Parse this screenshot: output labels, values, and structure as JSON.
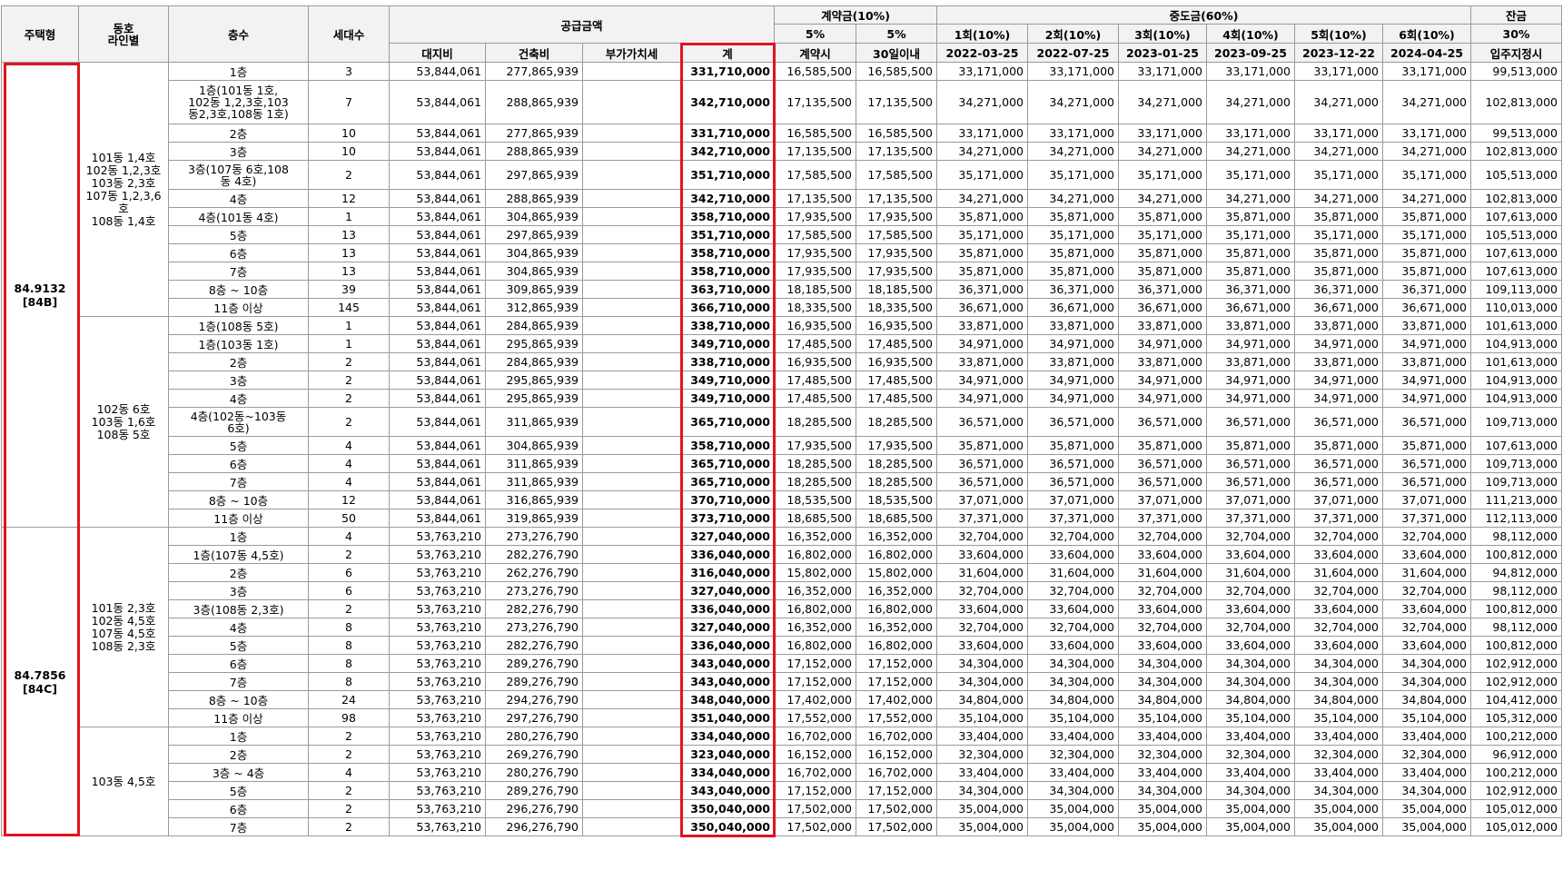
{
  "headers": {
    "type": "주택형",
    "line": "동호\n라인별",
    "floor": "층수",
    "units": "세대수",
    "supply": "공급금액",
    "land": "대지비",
    "building": "건축비",
    "vat": "부가가치세",
    "total": "계",
    "deposit": "계약금(10%)",
    "deposit_pct1": "5%",
    "deposit_pct2": "5%",
    "deposit_sub1": "계약시",
    "deposit_sub2": "30일이내",
    "middle": "중도금(60%)",
    "installments": [
      {
        "label": "1회(10%)",
        "date": "2022-03-25"
      },
      {
        "label": "2회(10%)",
        "date": "2022-07-25"
      },
      {
        "label": "3회(10%)",
        "date": "2023-01-25"
      },
      {
        "label": "4회(10%)",
        "date": "2023-09-25"
      },
      {
        "label": "5회(10%)",
        "date": "2023-12-22"
      },
      {
        "label": "6회(10%)",
        "date": "2024-04-25"
      }
    ],
    "balance": "잔금",
    "balance_pct": "30%",
    "balance_sub": "입주지정시"
  },
  "groups": [
    {
      "type": "84.9132\n[84B]",
      "lines": [
        {
          "label": "101동 1,4호\n102동 1,2,3호\n103동 2,3호\n107동 1,2,3,6호\n108동 1,4호",
          "rows": [
            {
              "floor": "1층",
              "units": "3",
              "land": "53,844,061",
              "building": "277,865,939",
              "total": "331,710,000",
              "d1": "16,585,500",
              "d2": "16,585,500",
              "mid": "33,171,000",
              "bal": "99,513,000"
            },
            {
              "floor": "1층(101동 1호,\n102동 1,2,3호,103\n동2,3호,108동 1호)",
              "units": "7",
              "land": "53,844,061",
              "building": "288,865,939",
              "total": "342,710,000",
              "d1": "17,135,500",
              "d2": "17,135,500",
              "mid": "34,271,000",
              "bal": "102,813,000"
            },
            {
              "floor": "2층",
              "units": "10",
              "land": "53,844,061",
              "building": "277,865,939",
              "total": "331,710,000",
              "d1": "16,585,500",
              "d2": "16,585,500",
              "mid": "33,171,000",
              "bal": "99,513,000"
            },
            {
              "floor": "3층",
              "units": "10",
              "land": "53,844,061",
              "building": "288,865,939",
              "total": "342,710,000",
              "d1": "17,135,500",
              "d2": "17,135,500",
              "mid": "34,271,000",
              "bal": "102,813,000"
            },
            {
              "floor": "3층(107동 6호,108\n동 4호)",
              "units": "2",
              "land": "53,844,061",
              "building": "297,865,939",
              "total": "351,710,000",
              "d1": "17,585,500",
              "d2": "17,585,500",
              "mid": "35,171,000",
              "bal": "105,513,000"
            },
            {
              "floor": "4층",
              "units": "12",
              "land": "53,844,061",
              "building": "288,865,939",
              "total": "342,710,000",
              "d1": "17,135,500",
              "d2": "17,135,500",
              "mid": "34,271,000",
              "bal": "102,813,000"
            },
            {
              "floor": "4층(101동 4호)",
              "units": "1",
              "land": "53,844,061",
              "building": "304,865,939",
              "total": "358,710,000",
              "d1": "17,935,500",
              "d2": "17,935,500",
              "mid": "35,871,000",
              "bal": "107,613,000"
            },
            {
              "floor": "5층",
              "units": "13",
              "land": "53,844,061",
              "building": "297,865,939",
              "total": "351,710,000",
              "d1": "17,585,500",
              "d2": "17,585,500",
              "mid": "35,171,000",
              "bal": "105,513,000"
            },
            {
              "floor": "6층",
              "units": "13",
              "land": "53,844,061",
              "building": "304,865,939",
              "total": "358,710,000",
              "d1": "17,935,500",
              "d2": "17,935,500",
              "mid": "35,871,000",
              "bal": "107,613,000"
            },
            {
              "floor": "7층",
              "units": "13",
              "land": "53,844,061",
              "building": "304,865,939",
              "total": "358,710,000",
              "d1": "17,935,500",
              "d2": "17,935,500",
              "mid": "35,871,000",
              "bal": "107,613,000"
            },
            {
              "floor": "8층 ~ 10층",
              "units": "39",
              "land": "53,844,061",
              "building": "309,865,939",
              "total": "363,710,000",
              "d1": "18,185,500",
              "d2": "18,185,500",
              "mid": "36,371,000",
              "bal": "109,113,000"
            },
            {
              "floor": "11층 이상",
              "units": "145",
              "land": "53,844,061",
              "building": "312,865,939",
              "total": "366,710,000",
              "d1": "18,335,500",
              "d2": "18,335,500",
              "mid": "36,671,000",
              "bal": "110,013,000"
            }
          ]
        },
        {
          "label": "102동 6호\n103동 1,6호\n108동 5호",
          "rows": [
            {
              "floor": "1층(108동 5호)",
              "units": "1",
              "land": "53,844,061",
              "building": "284,865,939",
              "total": "338,710,000",
              "d1": "16,935,500",
              "d2": "16,935,500",
              "mid": "33,871,000",
              "bal": "101,613,000"
            },
            {
              "floor": "1층(103동 1호)",
              "units": "1",
              "land": "53,844,061",
              "building": "295,865,939",
              "total": "349,710,000",
              "d1": "17,485,500",
              "d2": "17,485,500",
              "mid": "34,971,000",
              "bal": "104,913,000"
            },
            {
              "floor": "2층",
              "units": "2",
              "land": "53,844,061",
              "building": "284,865,939",
              "total": "338,710,000",
              "d1": "16,935,500",
              "d2": "16,935,500",
              "mid": "33,871,000",
              "bal": "101,613,000"
            },
            {
              "floor": "3층",
              "units": "2",
              "land": "53,844,061",
              "building": "295,865,939",
              "total": "349,710,000",
              "d1": "17,485,500",
              "d2": "17,485,500",
              "mid": "34,971,000",
              "bal": "104,913,000"
            },
            {
              "floor": "4층",
              "units": "2",
              "land": "53,844,061",
              "building": "295,865,939",
              "total": "349,710,000",
              "d1": "17,485,500",
              "d2": "17,485,500",
              "mid": "34,971,000",
              "bal": "104,913,000"
            },
            {
              "floor": "4층(102동~103동\n6호)",
              "units": "2",
              "land": "53,844,061",
              "building": "311,865,939",
              "total": "365,710,000",
              "d1": "18,285,500",
              "d2": "18,285,500",
              "mid": "36,571,000",
              "bal": "109,713,000"
            },
            {
              "floor": "5층",
              "units": "4",
              "land": "53,844,061",
              "building": "304,865,939",
              "total": "358,710,000",
              "d1": "17,935,500",
              "d2": "17,935,500",
              "mid": "35,871,000",
              "bal": "107,613,000"
            },
            {
              "floor": "6층",
              "units": "4",
              "land": "53,844,061",
              "building": "311,865,939",
              "total": "365,710,000",
              "d1": "18,285,500",
              "d2": "18,285,500",
              "mid": "36,571,000",
              "bal": "109,713,000"
            },
            {
              "floor": "7층",
              "units": "4",
              "land": "53,844,061",
              "building": "311,865,939",
              "total": "365,710,000",
              "d1": "18,285,500",
              "d2": "18,285,500",
              "mid": "36,571,000",
              "bal": "109,713,000"
            },
            {
              "floor": "8층 ~ 10층",
              "units": "12",
              "land": "53,844,061",
              "building": "316,865,939",
              "total": "370,710,000",
              "d1": "18,535,500",
              "d2": "18,535,500",
              "mid": "37,071,000",
              "bal": "111,213,000"
            },
            {
              "floor": "11층 이상",
              "units": "50",
              "land": "53,844,061",
              "building": "319,865,939",
              "total": "373,710,000",
              "d1": "18,685,500",
              "d2": "18,685,500",
              "mid": "37,371,000",
              "bal": "112,113,000"
            }
          ]
        }
      ]
    },
    {
      "type": "84.7856\n[84C]",
      "lines": [
        {
          "label": "101동 2,3호\n102동 4,5호\n107동 4,5호\n108동 2,3호",
          "rows": [
            {
              "floor": "1층",
              "units": "4",
              "land": "53,763,210",
              "building": "273,276,790",
              "total": "327,040,000",
              "d1": "16,352,000",
              "d2": "16,352,000",
              "mid": "32,704,000",
              "bal": "98,112,000"
            },
            {
              "floor": "1층(107동 4,5호)",
              "units": "2",
              "land": "53,763,210",
              "building": "282,276,790",
              "total": "336,040,000",
              "d1": "16,802,000",
              "d2": "16,802,000",
              "mid": "33,604,000",
              "bal": "100,812,000"
            },
            {
              "floor": "2층",
              "units": "6",
              "land": "53,763,210",
              "building": "262,276,790",
              "total": "316,040,000",
              "d1": "15,802,000",
              "d2": "15,802,000",
              "mid": "31,604,000",
              "bal": "94,812,000"
            },
            {
              "floor": "3층",
              "units": "6",
              "land": "53,763,210",
              "building": "273,276,790",
              "total": "327,040,000",
              "d1": "16,352,000",
              "d2": "16,352,000",
              "mid": "32,704,000",
              "bal": "98,112,000"
            },
            {
              "floor": "3층(108동 2,3호)",
              "units": "2",
              "land": "53,763,210",
              "building": "282,276,790",
              "total": "336,040,000",
              "d1": "16,802,000",
              "d2": "16,802,000",
              "mid": "33,604,000",
              "bal": "100,812,000"
            },
            {
              "floor": "4층",
              "units": "8",
              "land": "53,763,210",
              "building": "273,276,790",
              "total": "327,040,000",
              "d1": "16,352,000",
              "d2": "16,352,000",
              "mid": "32,704,000",
              "bal": "98,112,000"
            },
            {
              "floor": "5층",
              "units": "8",
              "land": "53,763,210",
              "building": "282,276,790",
              "total": "336,040,000",
              "d1": "16,802,000",
              "d2": "16,802,000",
              "mid": "33,604,000",
              "bal": "100,812,000"
            },
            {
              "floor": "6층",
              "units": "8",
              "land": "53,763,210",
              "building": "289,276,790",
              "total": "343,040,000",
              "d1": "17,152,000",
              "d2": "17,152,000",
              "mid": "34,304,000",
              "bal": "102,912,000"
            },
            {
              "floor": "7층",
              "units": "8",
              "land": "53,763,210",
              "building": "289,276,790",
              "total": "343,040,000",
              "d1": "17,152,000",
              "d2": "17,152,000",
              "mid": "34,304,000",
              "bal": "102,912,000"
            },
            {
              "floor": "8층 ~ 10층",
              "units": "24",
              "land": "53,763,210",
              "building": "294,276,790",
              "total": "348,040,000",
              "d1": "17,402,000",
              "d2": "17,402,000",
              "mid": "34,804,000",
              "bal": "104,412,000"
            },
            {
              "floor": "11층 이상",
              "units": "98",
              "land": "53,763,210",
              "building": "297,276,790",
              "total": "351,040,000",
              "d1": "17,552,000",
              "d2": "17,552,000",
              "mid": "35,104,000",
              "bal": "105,312,000"
            }
          ]
        },
        {
          "label": "103동 4,5호",
          "rows": [
            {
              "floor": "1층",
              "units": "2",
              "land": "53,763,210",
              "building": "280,276,790",
              "total": "334,040,000",
              "d1": "16,702,000",
              "d2": "16,702,000",
              "mid": "33,404,000",
              "bal": "100,212,000"
            },
            {
              "floor": "2층",
              "units": "2",
              "land": "53,763,210",
              "building": "269,276,790",
              "total": "323,040,000",
              "d1": "16,152,000",
              "d2": "16,152,000",
              "mid": "32,304,000",
              "bal": "96,912,000"
            },
            {
              "floor": "3층 ~ 4층",
              "units": "4",
              "land": "53,763,210",
              "building": "280,276,790",
              "total": "334,040,000",
              "d1": "16,702,000",
              "d2": "16,702,000",
              "mid": "33,404,000",
              "bal": "100,212,000"
            },
            {
              "floor": "5층",
              "units": "2",
              "land": "53,763,210",
              "building": "289,276,790",
              "total": "343,040,000",
              "d1": "17,152,000",
              "d2": "17,152,000",
              "mid": "34,304,000",
              "bal": "102,912,000"
            },
            {
              "floor": "6층",
              "units": "2",
              "land": "53,763,210",
              "building": "296,276,790",
              "total": "350,040,000",
              "d1": "17,502,000",
              "d2": "17,502,000",
              "mid": "35,004,000",
              "bal": "105,012,000"
            },
            {
              "floor": "7층",
              "units": "2",
              "land": "53,763,210",
              "building": "296,276,790",
              "total": "350,040,000",
              "d1": "17,502,000",
              "d2": "17,502,000",
              "mid": "35,004,000",
              "bal": "105,012,000"
            }
          ]
        }
      ]
    }
  ],
  "colors": {
    "highlight": "#e0141e",
    "header_bg": "#f2f2f2",
    "grid": "#9a9a9a"
  }
}
